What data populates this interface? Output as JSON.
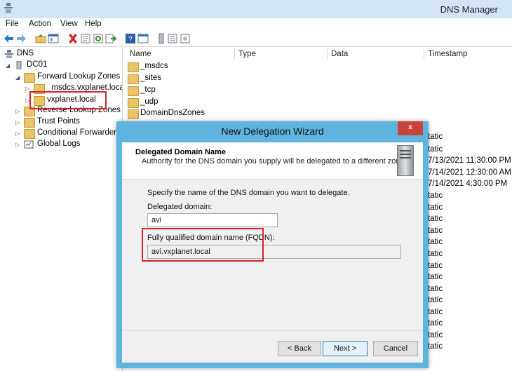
{
  "window": {
    "title": "DNS Manager"
  },
  "menu": [
    "File",
    "Action",
    "View",
    "Help"
  ],
  "tree": {
    "root": "DNS",
    "server": "DC01",
    "forward_zones": "Forward Lookup Zones",
    "msdcs_zone": "_msdcs.vxplanet.loca",
    "vxplanet_zone": "vxplanet.local",
    "reverse_zones": "Reverse Lookup Zones",
    "trust_points": "Trust Points",
    "conditional_forwarders": "Conditional Forwarders",
    "global_logs": "Global Logs"
  },
  "columns": {
    "name": "Name",
    "type": "Type",
    "data": "Data",
    "timestamp": "Timestamp"
  },
  "list": [
    "_msdcs",
    "_sites",
    "_tcp",
    "_udp",
    "DomainDnsZones"
  ],
  "timestamps_visible": [
    "tatic",
    "tatic",
    "7/13/2021 11:30:00 PM",
    "7/14/2021 12:30:00 AM",
    "7/14/2021 4:30:00 PM",
    "tatic",
    "tatic",
    "tatic",
    "tatic",
    "tatic",
    "tatic",
    "tatic",
    "tatic",
    "tatic",
    "tatic",
    "tatic",
    "tatic",
    "tatic",
    "tatic"
  ],
  "dialog": {
    "title": "New Delegation Wizard",
    "close": "x",
    "header_title": "Delegated Domain Name",
    "header_sub": "Authority for the DNS domain you supply will be delegated to a different zone.",
    "instruction": "Specify the name of the DNS domain you want to delegate.",
    "delegated_label": "Delegated domain:",
    "delegated_value": "avi",
    "fqdn_label": "Fully qualified domain name (FQDN):",
    "fqdn_value": "avi.vxplanet.local",
    "back": "< Back",
    "next": "Next >",
    "cancel": "Cancel"
  },
  "colors": {
    "dialog_frame": "#5fb3df",
    "highlight": "#d9222a",
    "close": "#c8443a"
  }
}
